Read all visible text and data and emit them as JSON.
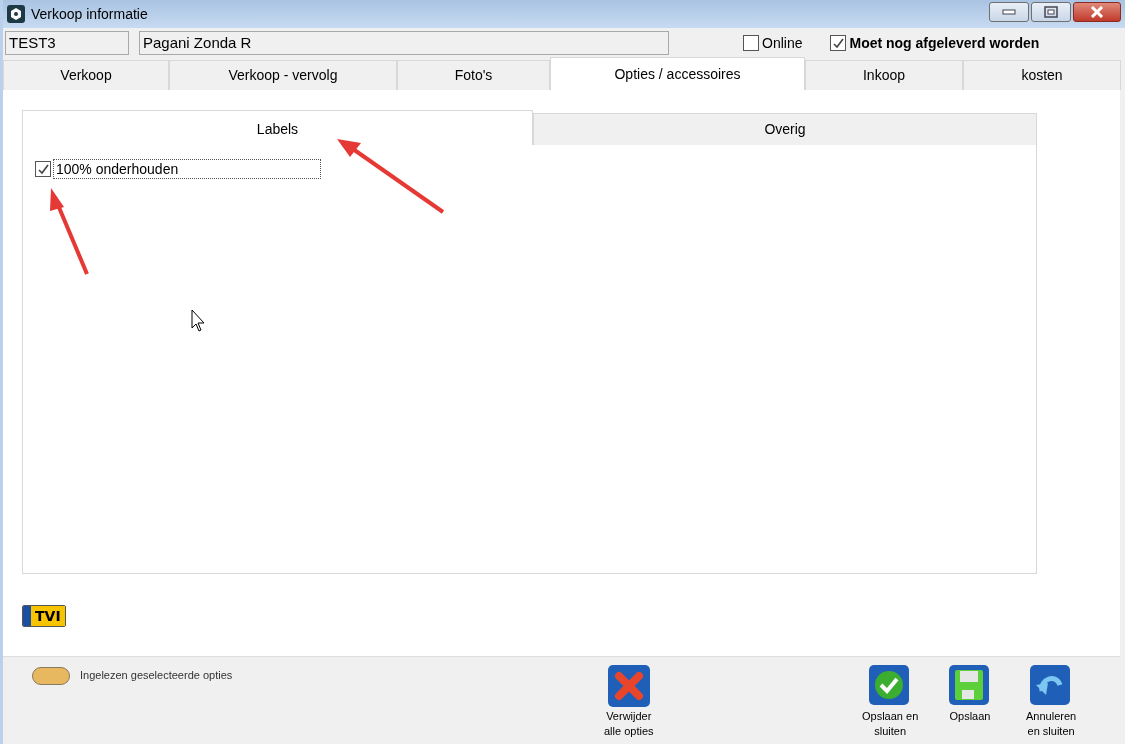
{
  "window": {
    "title": "Verkoop informatie"
  },
  "header": {
    "code": "TEST3",
    "name": "Pagani Zonda R",
    "checkboxes": [
      {
        "label": "Online",
        "checked": false
      },
      {
        "label": "Moet nog afgeleverd worden",
        "checked": true
      }
    ]
  },
  "tabs": [
    {
      "label": "Verkoop",
      "selected": false
    },
    {
      "label": "Verkoop - vervolg",
      "selected": false
    },
    {
      "label": "Foto's",
      "selected": false
    },
    {
      "label": "Opties / accessoires",
      "selected": true
    },
    {
      "label": "Inkoop",
      "selected": false
    },
    {
      "label": "kosten",
      "selected": false
    }
  ],
  "subtabs": [
    {
      "label": "Labels",
      "selected": true
    },
    {
      "label": "Overig",
      "selected": false
    }
  ],
  "options": [
    {
      "label": "100% onderhouden",
      "checked": true
    }
  ],
  "plate": {
    "text": "TVI"
  },
  "legend": {
    "label": "Ingelezen geselecteerde opties"
  },
  "actions": [
    {
      "kind": "delete",
      "label": "Verwijder\nalle opties"
    },
    {
      "kind": "save_close",
      "label": "Opslaan en\nsluiten"
    },
    {
      "kind": "save",
      "label": "Opslaan"
    },
    {
      "kind": "cancel",
      "label": "Annuleren\nen sluiten"
    }
  ]
}
